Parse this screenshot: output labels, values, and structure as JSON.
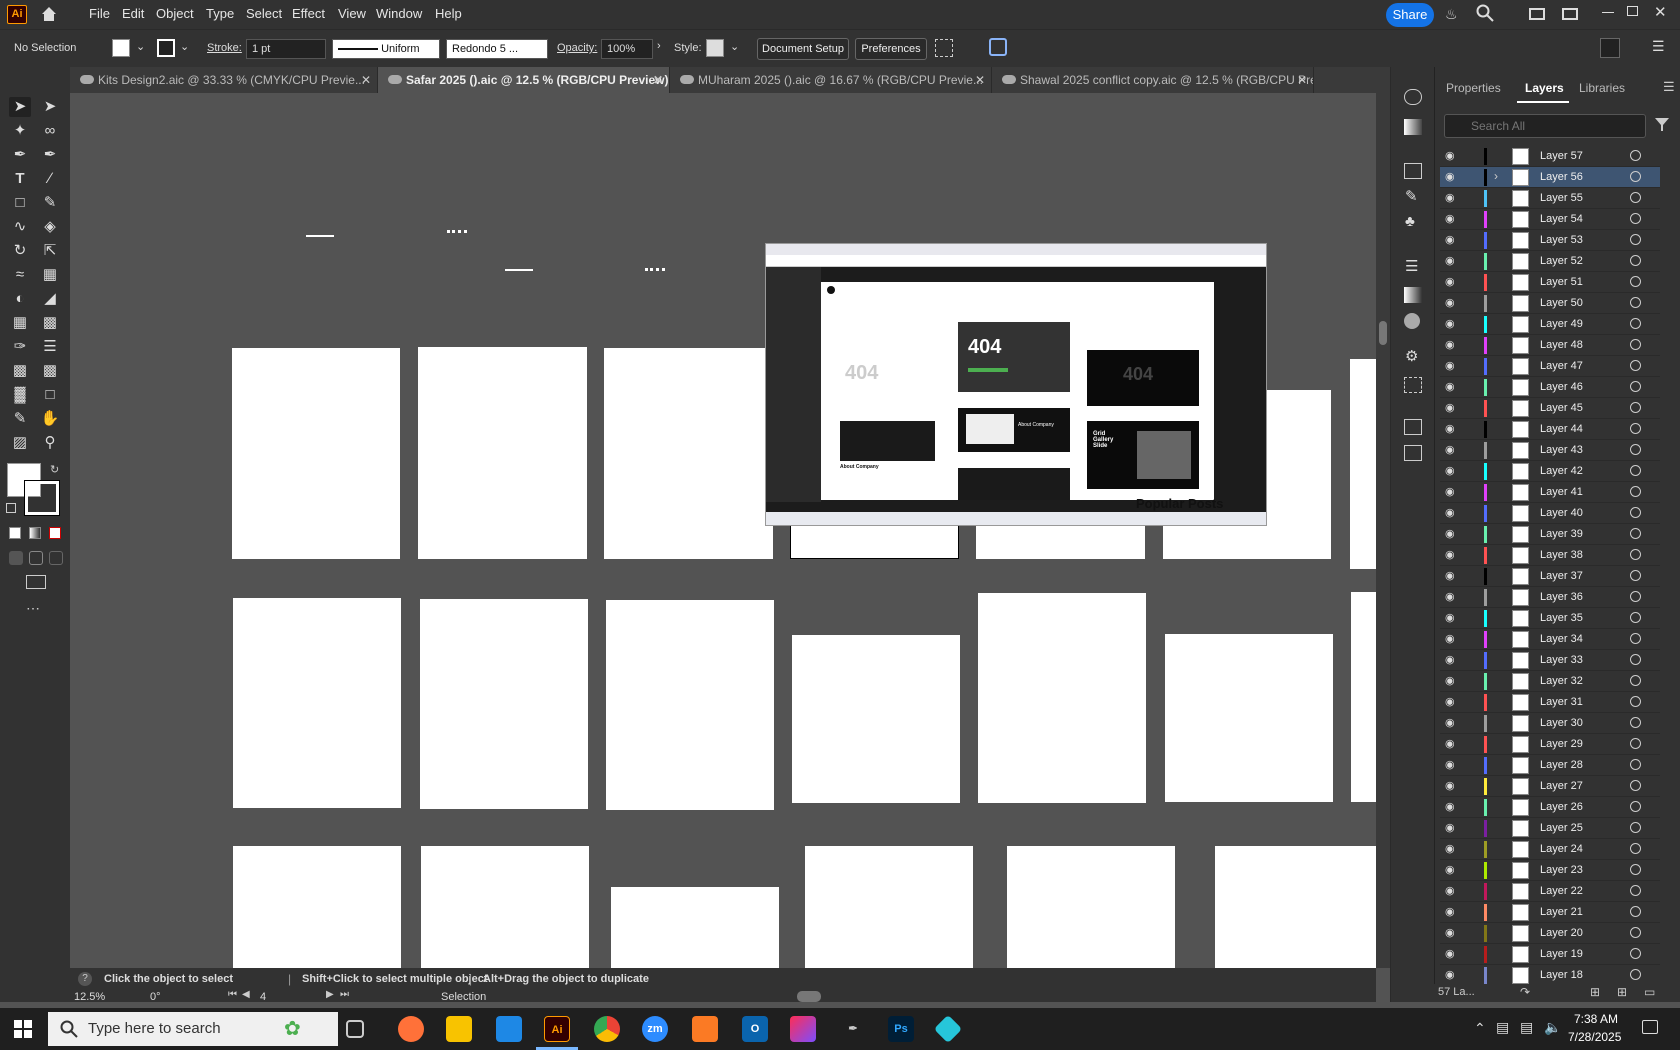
{
  "menubar": {
    "logo": "Ai",
    "items": [
      "File",
      "Edit",
      "Object",
      "Type",
      "Select",
      "Effect",
      "View",
      "Window",
      "Help"
    ],
    "share": "Share"
  },
  "control": {
    "selection": "No Selection",
    "stroke_label": "Stroke:",
    "stroke_value": "1 pt",
    "stroke_style": "Uniform",
    "brush": "Redondo 5 ...",
    "opacity_label": "Opacity:",
    "opacity_value": "100%",
    "style_label": "Style:",
    "doc_setup": "Document Setup",
    "preferences": "Preferences"
  },
  "tabs": [
    {
      "label": "Kits Design2.aic @ 33.33 % (CMYK/CPU Previe...",
      "active": false
    },
    {
      "label": "Safar 2025 ().aic @ 12.5 % (RGB/CPU Preview)",
      "active": true
    },
    {
      "label": "MUharam 2025 ().aic @ 16.67 % (RGB/CPU Previe...",
      "active": false
    },
    {
      "label": "Shawal 2025 conflict copy.aic @ 12.5 % (RGB/CPU Pre...",
      "active": false
    }
  ],
  "panel": {
    "tabs": [
      "Properties",
      "Layers",
      "Libraries"
    ],
    "search_placeholder": "Search All",
    "footer_count": "57 La..."
  },
  "layers": [
    {
      "name": "Layer 57",
      "color": "#000000"
    },
    {
      "name": "Layer 56",
      "color": "#000000",
      "selected": true
    },
    {
      "name": "Layer 55",
      "color": "#4fc3f7"
    },
    {
      "name": "Layer 54",
      "color": "#e040fb"
    },
    {
      "name": "Layer 53",
      "color": "#536dfe"
    },
    {
      "name": "Layer 52",
      "color": "#69f0ae"
    },
    {
      "name": "Layer 51",
      "color": "#ff5252"
    },
    {
      "name": "Layer 50",
      "color": "#9e9e9e"
    },
    {
      "name": "Layer 49",
      "color": "#18ffff"
    },
    {
      "name": "Layer 48",
      "color": "#e040fb"
    },
    {
      "name": "Layer 47",
      "color": "#536dfe"
    },
    {
      "name": "Layer 46",
      "color": "#69f0ae"
    },
    {
      "name": "Layer 45",
      "color": "#ff5252"
    },
    {
      "name": "Layer 44",
      "color": "#000000"
    },
    {
      "name": "Layer 43",
      "color": "#9e9e9e"
    },
    {
      "name": "Layer 42",
      "color": "#18ffff"
    },
    {
      "name": "Layer 41",
      "color": "#e040fb"
    },
    {
      "name": "Layer 40",
      "color": "#536dfe"
    },
    {
      "name": "Layer 39",
      "color": "#69f0ae"
    },
    {
      "name": "Layer 38",
      "color": "#ff5252"
    },
    {
      "name": "Layer 37",
      "color": "#000000"
    },
    {
      "name": "Layer 36",
      "color": "#9e9e9e"
    },
    {
      "name": "Layer 35",
      "color": "#18ffff"
    },
    {
      "name": "Layer 34",
      "color": "#e040fb"
    },
    {
      "name": "Layer 33",
      "color": "#536dfe"
    },
    {
      "name": "Layer 32",
      "color": "#69f0ae"
    },
    {
      "name": "Layer 31",
      "color": "#ff5252"
    },
    {
      "name": "Layer 30",
      "color": "#9e9e9e"
    },
    {
      "name": "Layer 29",
      "color": "#ff5252"
    },
    {
      "name": "Layer 28",
      "color": "#536dfe"
    },
    {
      "name": "Layer 27",
      "color": "#ffeb3b"
    },
    {
      "name": "Layer 26",
      "color": "#69f0ae"
    },
    {
      "name": "Layer 25",
      "color": "#7b1fa2"
    },
    {
      "name": "Layer 24",
      "color": "#9e9d24"
    },
    {
      "name": "Layer 23",
      "color": "#aeea00"
    },
    {
      "name": "Layer 22",
      "color": "#c2185b"
    },
    {
      "name": "Layer 21",
      "color": "#ff8a65"
    },
    {
      "name": "Layer 20",
      "color": "#827717"
    },
    {
      "name": "Layer 19",
      "color": "#b71c1c"
    },
    {
      "name": "Layer 18",
      "color": "#7986cb"
    }
  ],
  "status": {
    "hint1": "Click the object to select",
    "hint2": "Shift+Click to select multiple object",
    "hint3": "Alt+Drag the object to duplicate",
    "zoom": "12.5%",
    "rotation": "0°",
    "artboard": "4",
    "tool": "Selection"
  },
  "overlay": {
    "big404": "404",
    "heading": "Popular Posts",
    "about": "About Company",
    "gallery": "Grid Gallery Slide"
  },
  "taskbar": {
    "search": "Type here to search",
    "time": "7:38 AM",
    "date": "7/28/2025"
  }
}
